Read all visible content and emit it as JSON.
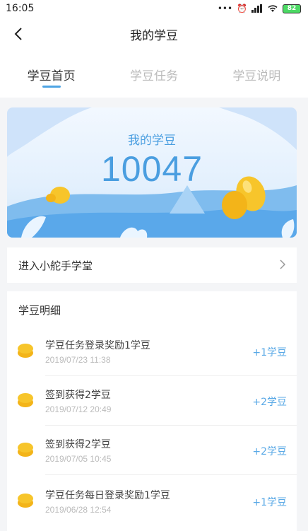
{
  "status_bar": {
    "time": "16:05",
    "battery": "82"
  },
  "nav": {
    "title": "我的学豆"
  },
  "tabs": [
    {
      "label": "学豆首页",
      "active": true
    },
    {
      "label": "学豆任务",
      "active": false
    },
    {
      "label": "学豆说明",
      "active": false
    }
  ],
  "hero": {
    "label": "我的学豆",
    "value": "10047"
  },
  "link": {
    "label": "进入小舵手学堂"
  },
  "details": {
    "title": "学豆明细",
    "records": [
      {
        "desc": "学豆任务登录奖励1学豆",
        "time": "2019/07/23 11:38",
        "amount": "+1学豆"
      },
      {
        "desc": "签到获得2学豆",
        "time": "2019/07/12 20:49",
        "amount": "+2学豆"
      },
      {
        "desc": "签到获得2学豆",
        "time": "2019/07/05 10:45",
        "amount": "+2学豆"
      },
      {
        "desc": "学豆任务每日登录奖励1学豆",
        "time": "2019/06/28 12:54",
        "amount": "+1学豆"
      }
    ]
  },
  "colors": {
    "accent": "#4ea4e3",
    "coin": "#f7c52b"
  }
}
